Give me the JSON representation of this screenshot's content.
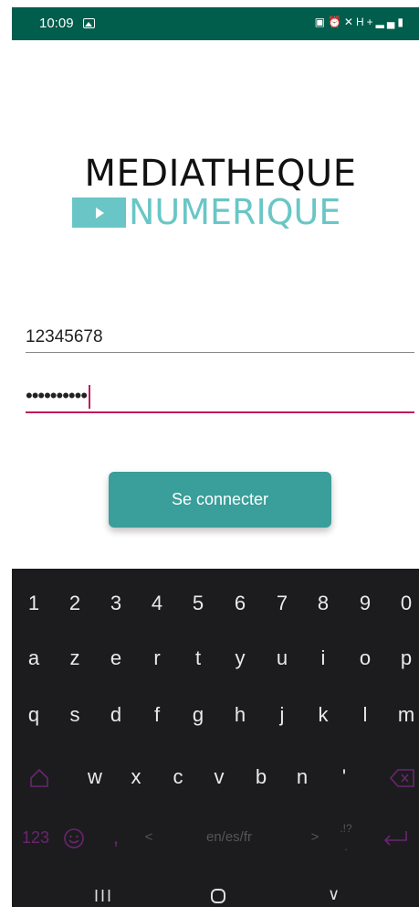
{
  "status_bar": {
    "time": "10:09",
    "right_icons": [
      "battery-saver-icon",
      "alarm-icon",
      "mute-icon",
      "network-h-plus-icon",
      "signal-icon",
      "battery-icon"
    ]
  },
  "logo": {
    "line1": "MEDIATHEQUE",
    "line2": "NUMERIQUE",
    "accent_color": "#6ac6c6"
  },
  "form": {
    "username_value": "12345678",
    "password_value": "••••••••••",
    "submit_label": "Se connecter",
    "accent_color": "#c2185b",
    "button_color": "#3a9e9a"
  },
  "keyboard": {
    "row_numbers": [
      "1",
      "2",
      "3",
      "4",
      "5",
      "6",
      "7",
      "8",
      "9",
      "0"
    ],
    "row_1": [
      "a",
      "z",
      "e",
      "r",
      "t",
      "y",
      "u",
      "i",
      "o",
      "p"
    ],
    "row_2": [
      "q",
      "s",
      "d",
      "f",
      "g",
      "h",
      "j",
      "k",
      "l",
      "m"
    ],
    "row_3": [
      "w",
      "x",
      "c",
      "v",
      "b",
      "n",
      "'"
    ],
    "mode_key": "123",
    "comma_key": ",",
    "space_label": "en/es/fr",
    "punct_key_top": ".!?",
    "punct_key_bottom": ".",
    "left_arrow": "<",
    "right_arrow": ">"
  },
  "nav_bar": {
    "recents": "III",
    "back": "∨"
  }
}
